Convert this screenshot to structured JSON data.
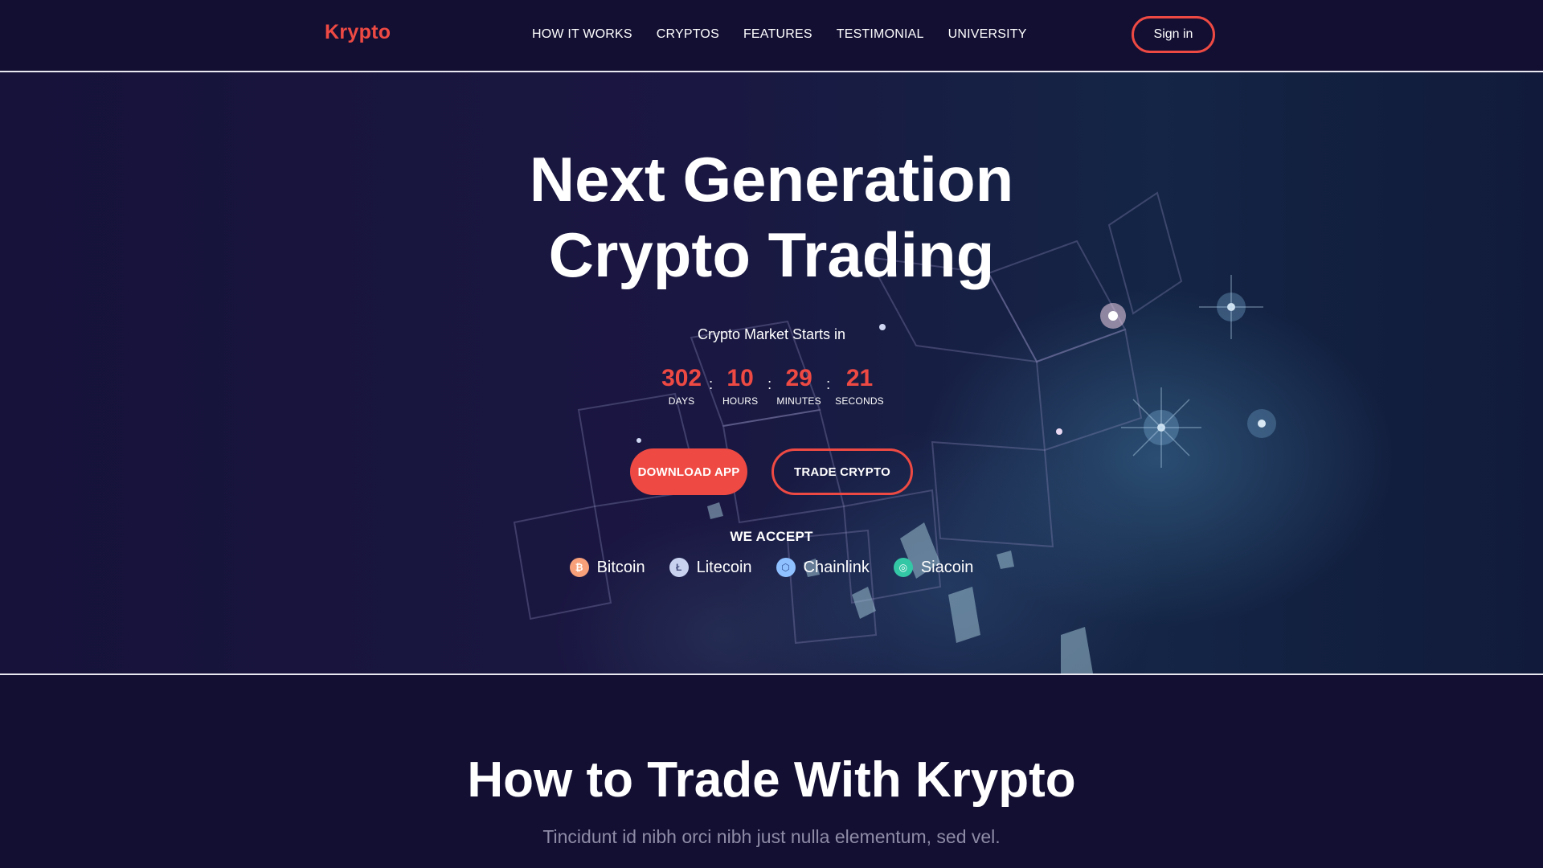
{
  "brand": {
    "name": "Krypto",
    "accent": "#ee4a43",
    "background": "#130f33"
  },
  "nav": {
    "links": [
      "HOW IT WORKS",
      "CRYPTOS",
      "FEATURES",
      "TESTIMONIAL",
      "UNIVERSITY"
    ],
    "signin_label": "Sign in"
  },
  "hero": {
    "title_line1": "Next Generation",
    "title_line2": "Crypto Trading",
    "market_label": "Crypto Market Starts in",
    "countdown": [
      {
        "value": "302",
        "label": "DAYS"
      },
      {
        "value": "10",
        "label": "HOURS"
      },
      {
        "value": "29",
        "label": "MINUTES"
      },
      {
        "value": "21",
        "label": "SECONDS"
      }
    ],
    "separator": ":",
    "download_label": "DOWNLOAD APP",
    "trade_label": "TRADE CRYPTO",
    "accept_label": "WE ACCEPT",
    "coins": [
      {
        "name": "Bitcoin",
        "icon": "bitcoin-icon",
        "glyph": "₿",
        "color": "#f7a07a"
      },
      {
        "name": "Litecoin",
        "icon": "litecoin-icon",
        "glyph": "Ł",
        "color": "#c9d3f0"
      },
      {
        "name": "Chainlink",
        "icon": "chainlink-icon",
        "glyph": "⬡",
        "color": "#8fc0ff"
      },
      {
        "name": "Siacoin",
        "icon": "siacoin-icon",
        "glyph": "◎",
        "color": "#34c7a6"
      }
    ]
  },
  "how_to": {
    "title": "How to Trade With Krypto",
    "subtitle": "Tincidunt id nibh orci nibh just nulla elementum, sed vel."
  }
}
